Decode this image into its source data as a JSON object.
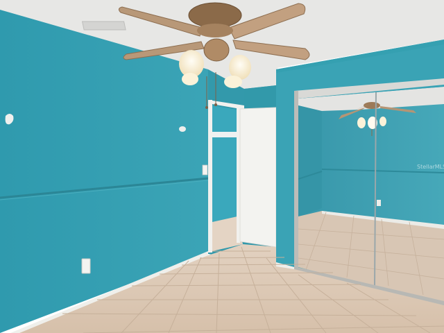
{
  "photo": {
    "watermark_text": "StellarMLS",
    "colors": {
      "wall_teal": "#3aa3b5",
      "wall_teal_dark": "#2f8fa0",
      "ceiling": "#e9e9e7",
      "floor_tile": "#dcc8b4",
      "grout": "#c9b39d",
      "baseboard": "#eeeeea",
      "door_white": "#f3f3f0",
      "fan_wood": "#b59575",
      "lamp_glass": "#fbf2d9"
    }
  }
}
